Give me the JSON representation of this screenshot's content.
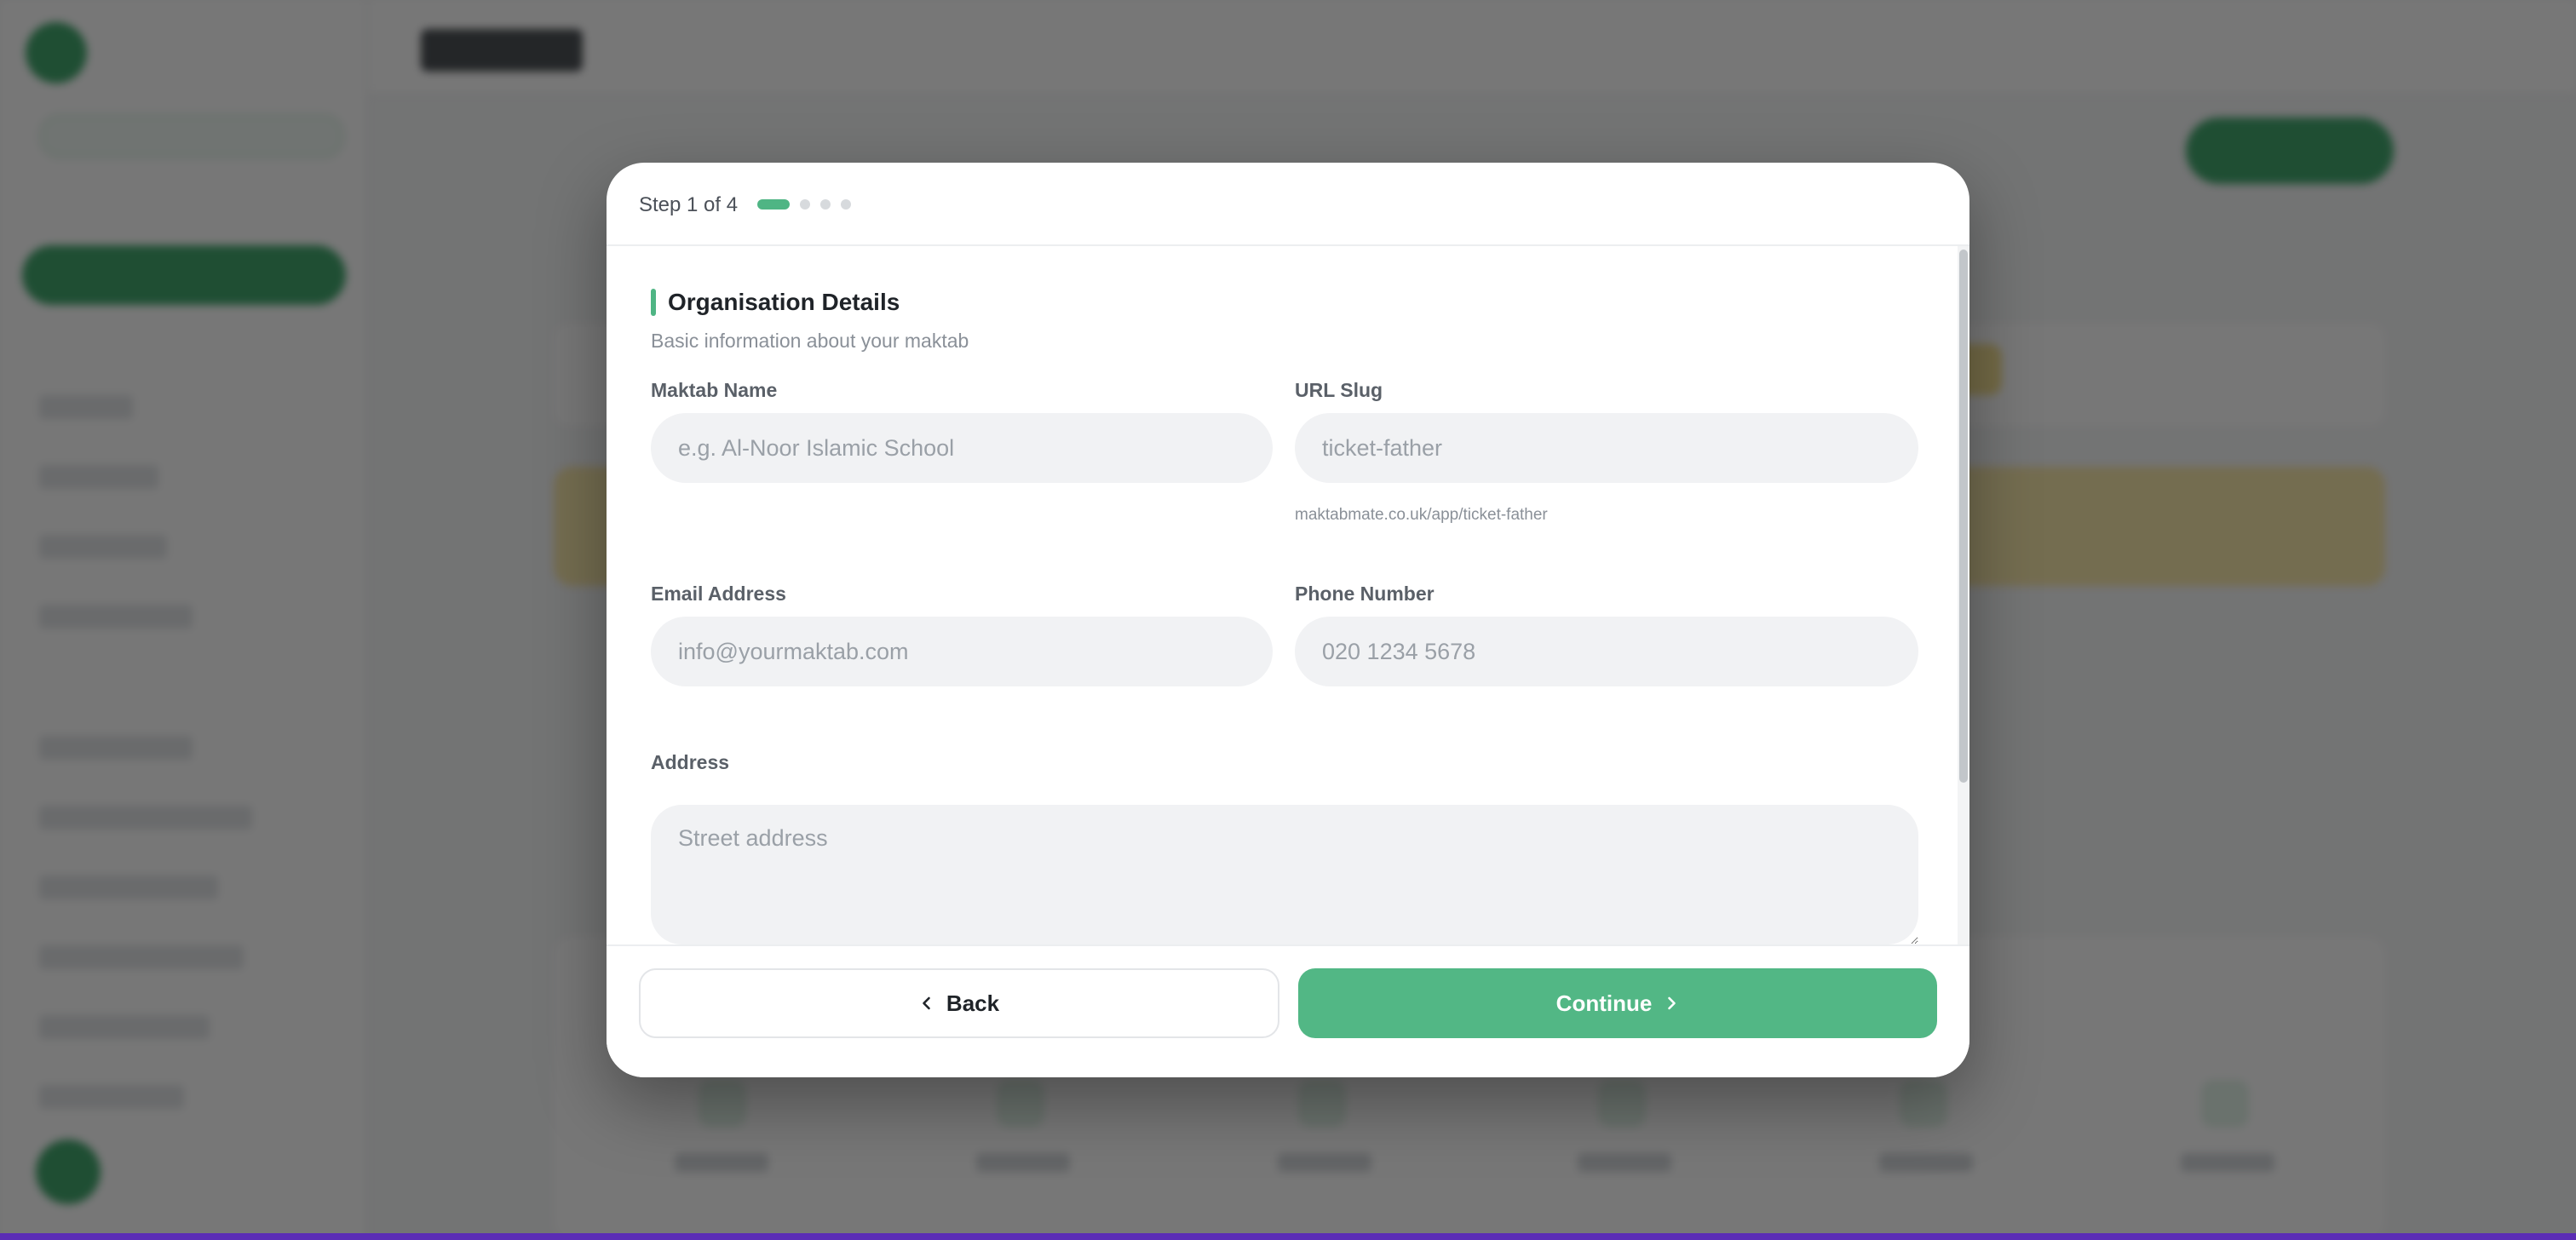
{
  "modal": {
    "step_label": "Step 1 of 4",
    "steps_total": 4,
    "current_step": 1,
    "section": {
      "title": "Organisation Details",
      "subtitle": "Basic information about your maktab"
    },
    "fields": {
      "maktab_name": {
        "label": "Maktab Name",
        "placeholder": "e.g. Al-Noor Islamic School",
        "value": ""
      },
      "url_slug": {
        "label": "URL Slug",
        "placeholder": "ticket-father",
        "value": "",
        "hint": "maktabmate.co.uk/app/ticket-father"
      },
      "email": {
        "label": "Email Address",
        "placeholder": "info@yourmaktab.com",
        "value": ""
      },
      "phone": {
        "label": "Phone Number",
        "placeholder": "020 1234 5678",
        "value": ""
      },
      "address": {
        "label": "Address",
        "placeholder": "Street address",
        "value": ""
      }
    },
    "buttons": {
      "back": "Back",
      "continue": "Continue"
    }
  },
  "colors": {
    "accent": "#52b785",
    "overlay": "rgba(20,20,20,0.58)"
  },
  "icons": [
    "chevron-left-icon",
    "chevron-right-icon"
  ]
}
